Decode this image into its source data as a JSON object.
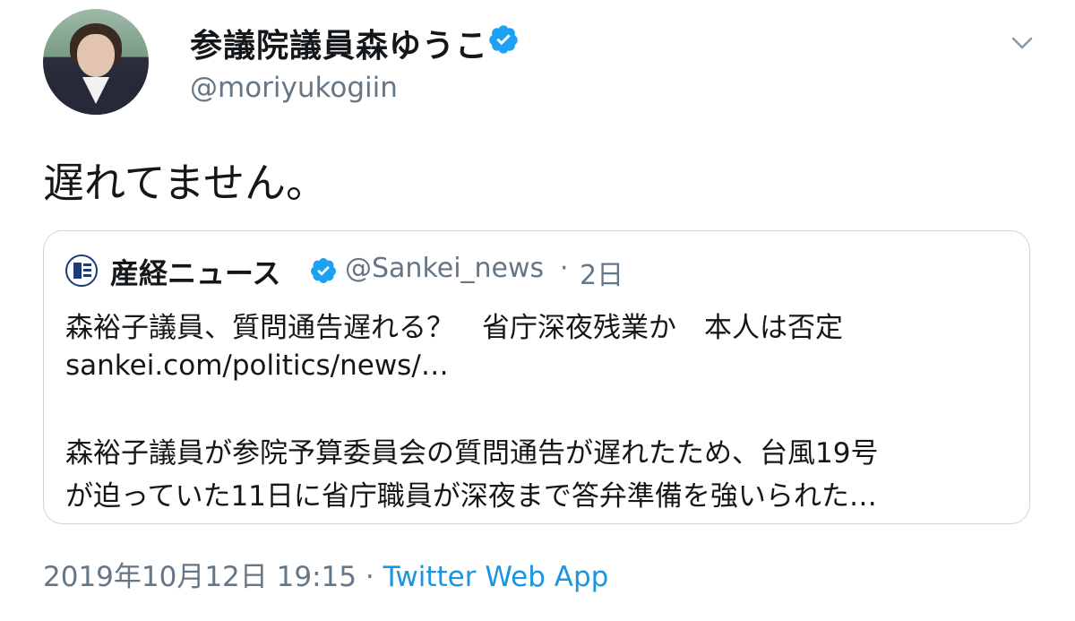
{
  "tweet": {
    "display_name": "参議院議員森ゆうこ",
    "handle": "@moriyukogiin",
    "text": "遅れてません。",
    "date": "2019年10月12日 19:15",
    "separator": "·",
    "source": "Twitter Web App"
  },
  "quoted": {
    "name": "産経ニュース",
    "handle": "@Sankei_news",
    "separator": "·",
    "time": "2日",
    "headline": "森裕子議員、質問通告遅れる？　省庁深夜残業か　本人は否定",
    "link": "sankei.com/politics/news/…",
    "body_line1": "森裕子議員が参院予算委員会の質問通告が遅れたため、台風19号",
    "body_line2": "が迫っていた11日に省庁職員が深夜まで答弁準備を強いられた…"
  },
  "colors": {
    "verified": "#1da1f2",
    "secondary_text": "#657786",
    "link": "#1b95e0",
    "border": "#ccd6dd"
  },
  "icons": [
    "verified-badge-icon",
    "chevron-down-icon",
    "sankei-logo-icon"
  ]
}
